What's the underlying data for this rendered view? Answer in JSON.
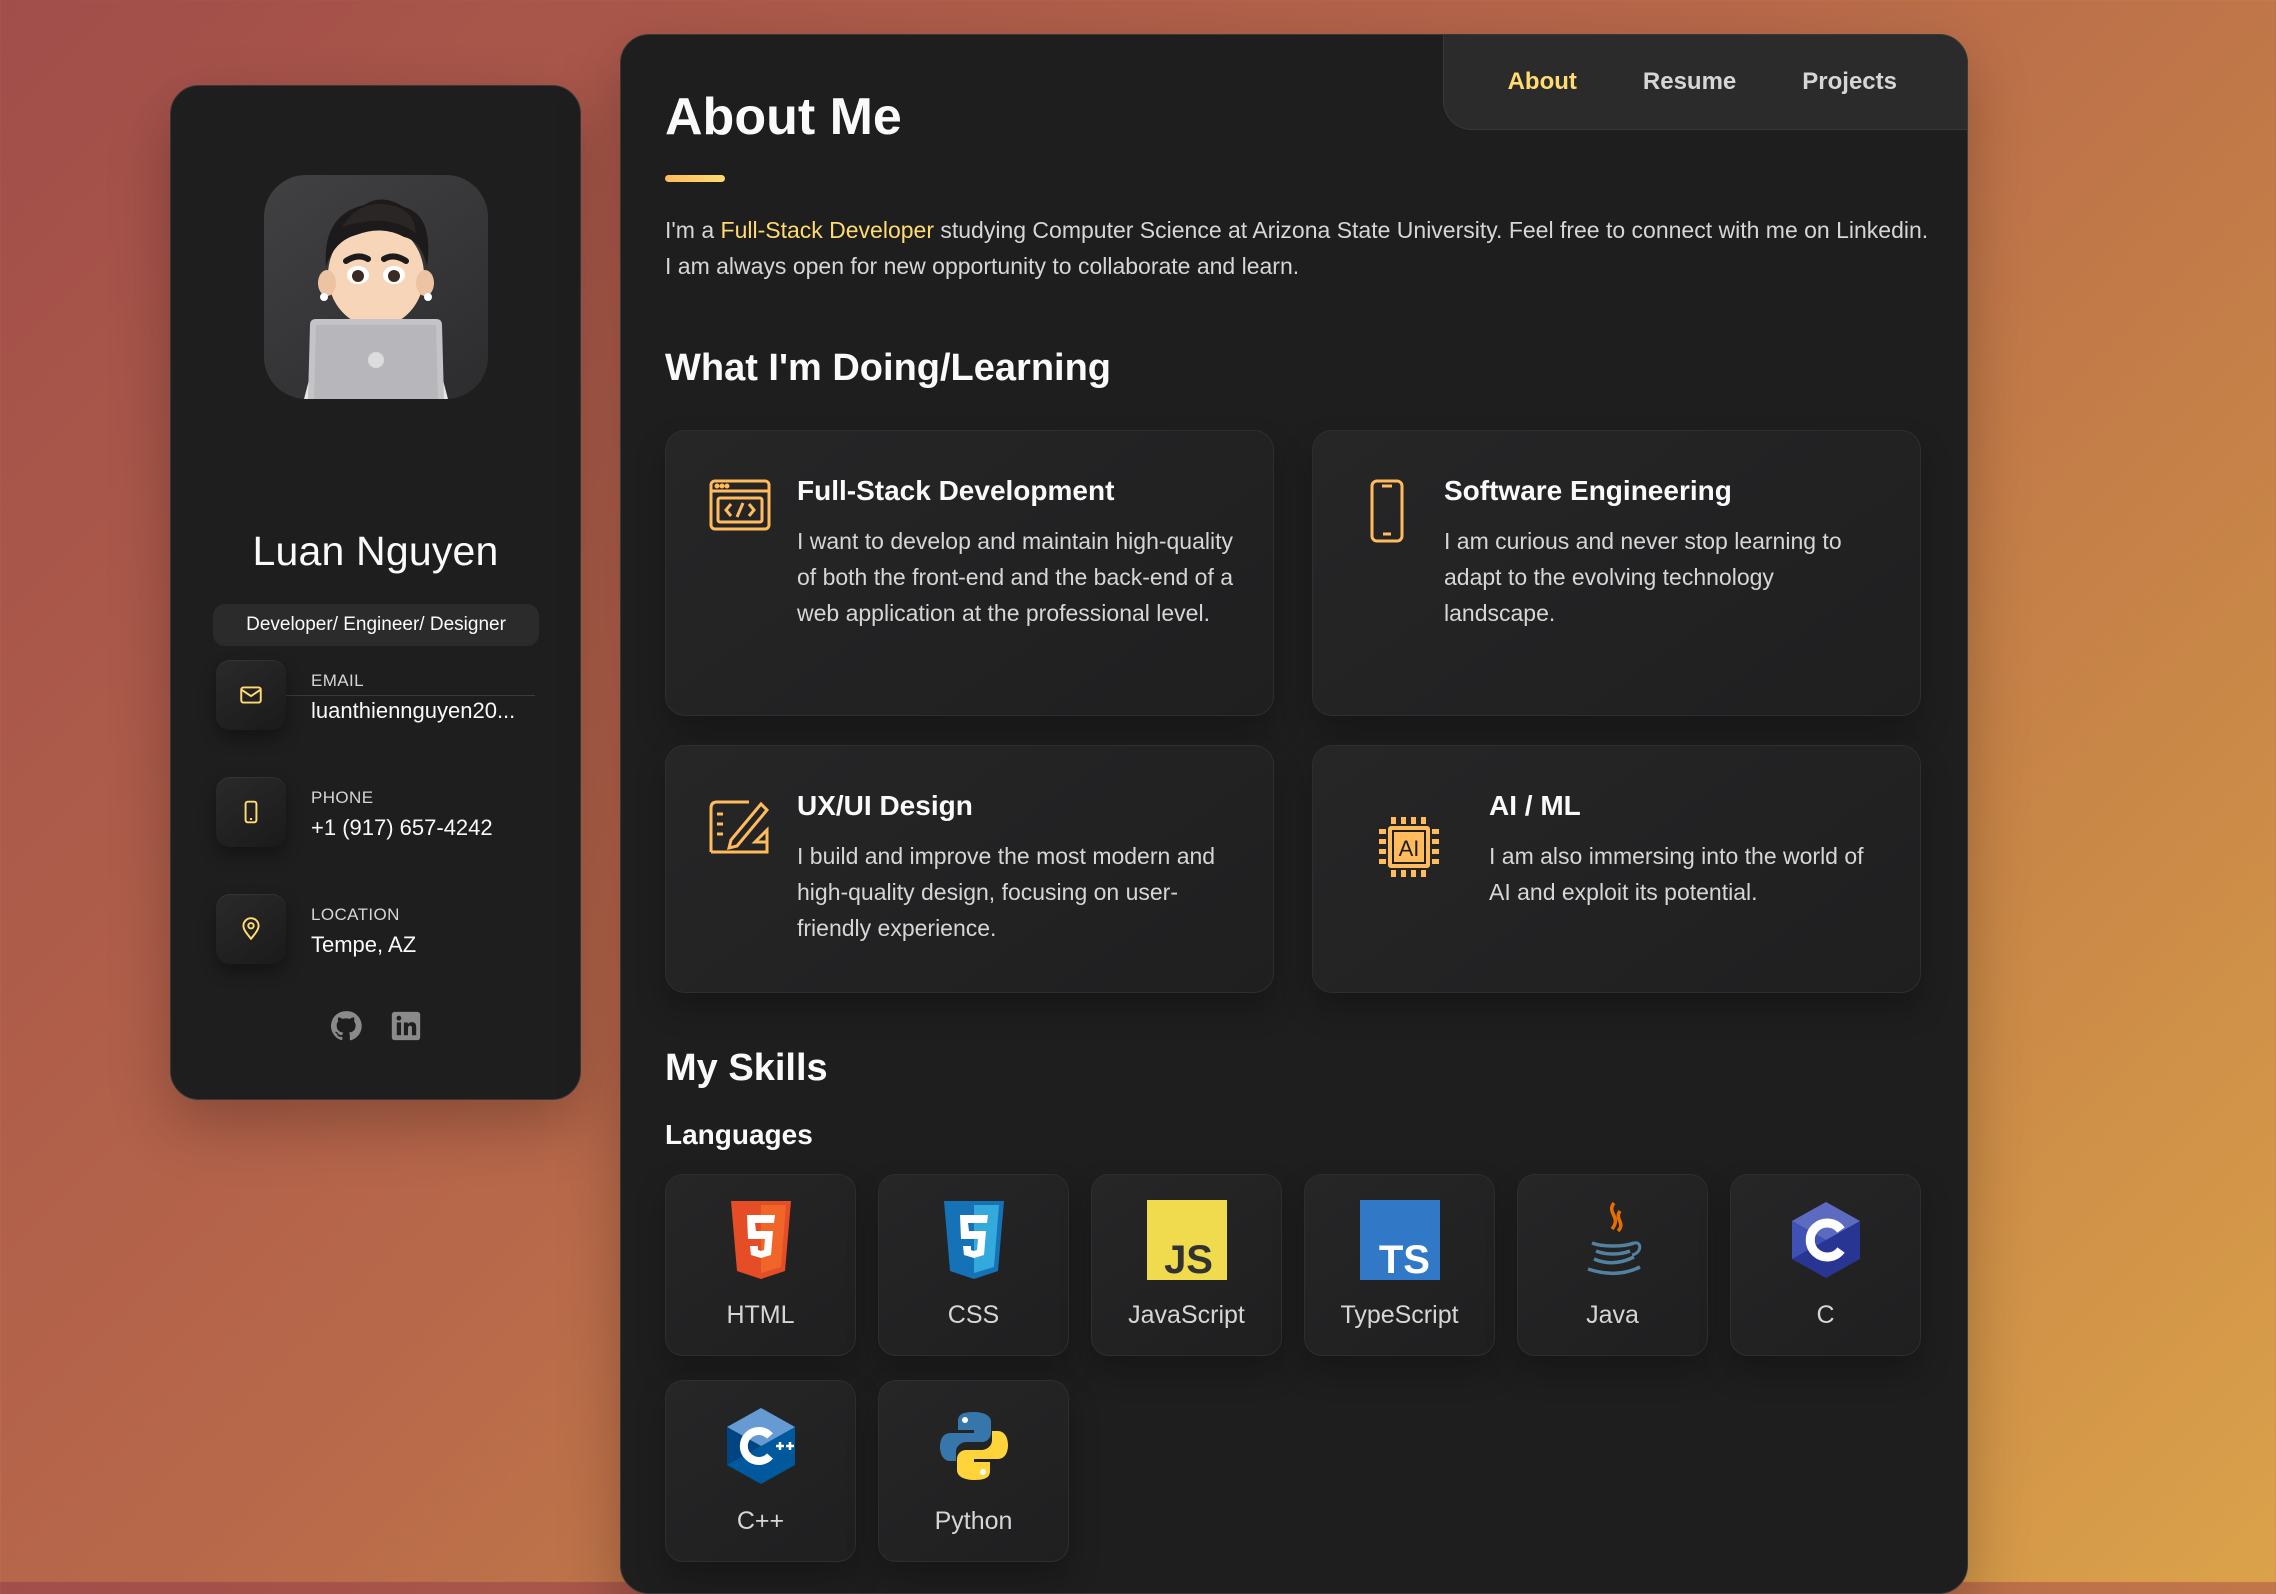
{
  "sidebar": {
    "name": "Luan Nguyen",
    "title": "Developer/ Engineer/ Designer",
    "contacts": [
      {
        "icon": "mail-icon",
        "label": "EMAIL",
        "value": "luanthiennguyen20..."
      },
      {
        "icon": "phone-icon",
        "label": "PHONE",
        "value": "+1 (917) 657-4242"
      },
      {
        "icon": "location-pin-icon",
        "label": "LOCATION",
        "value": "Tempe, AZ"
      }
    ],
    "socials": [
      "github-icon",
      "linkedin-icon"
    ]
  },
  "nav": {
    "items": [
      "About",
      "Resume",
      "Projects"
    ],
    "active": "About"
  },
  "about": {
    "heading": "About Me",
    "text_before": "I'm a ",
    "highlight": "Full-Stack Developer",
    "text_after": " studying Computer Science at Arizona State University. Feel free to connect with me on Linkedin. I am always open for new opportunity to collaborate and learn."
  },
  "services": {
    "heading": "What I'm Doing/Learning",
    "items": [
      {
        "icon": "code-window-icon",
        "title": "Full-Stack Development",
        "desc": "I want to develop and maintain high-quality of both the front-end and the back-end of a web application at the professional level."
      },
      {
        "icon": "smartphone-icon",
        "title": "Software Engineering",
        "desc": "I am curious and never stop learning to adapt to the evolving technology landscape."
      },
      {
        "icon": "design-tools-icon",
        "title": "UX/UI Design",
        "desc": "I build and improve the most modern and high-quality design, focusing on user-friendly experience."
      },
      {
        "icon": "ai-chip-icon",
        "title": "AI / ML",
        "desc": "I am also immersing into the world of AI and exploit its potential."
      }
    ]
  },
  "skills": {
    "heading": "My Skills",
    "subheading": "Languages",
    "items": [
      "HTML",
      "CSS",
      "JavaScript",
      "TypeScript",
      "Java",
      "C",
      "C++",
      "Python"
    ]
  },
  "colors": {
    "accent": "#ffdb70",
    "panel": "#1e1e1f",
    "card": "#262627",
    "text": "#d6d6d6"
  }
}
